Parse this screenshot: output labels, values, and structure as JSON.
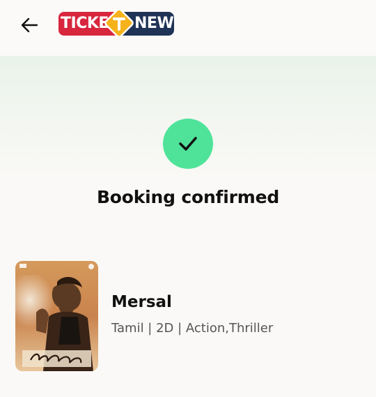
{
  "header": {
    "logo_left": "TICKE",
    "logo_right": "NEW",
    "back_icon": "arrow-left-icon"
  },
  "status": {
    "icon": "check-icon",
    "title": "Booking confirmed",
    "accent": "#4fe39a"
  },
  "movie": {
    "name": "Mersal",
    "meta": "Tamil | 2D | Action,Thriller"
  },
  "colors": {
    "logo_red": "#d7263d",
    "logo_navy": "#1f3356",
    "logo_yellow": "#f6b21b"
  }
}
